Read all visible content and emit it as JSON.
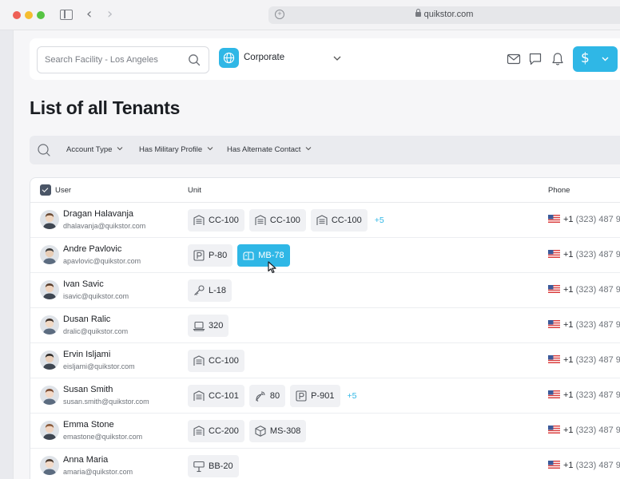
{
  "browser": {
    "url": "quikstor.com"
  },
  "header": {
    "search_placeholder": "Search Facility - Los Angeles",
    "organization": "Corporate",
    "icons": [
      "mail-icon",
      "chat-icon",
      "bell-icon"
    ],
    "money_button_symbol": "$"
  },
  "page": {
    "title": "List of all Tenants"
  },
  "filters": [
    {
      "label": "Account Type"
    },
    {
      "label": "Has Military Profile"
    },
    {
      "label": "Has Alternate Contact"
    }
  ],
  "table": {
    "columns": {
      "user": "User",
      "unit": "Unit",
      "phone": "Phone"
    },
    "rows": [
      {
        "name": "Dragan Halavanja",
        "email": "dhalavanja@quikstor.com",
        "phone_cc": "+1",
        "phone_rest": "(323) 487 9",
        "units": [
          {
            "label": "CC-100",
            "icon": "building"
          },
          {
            "label": "CC-100",
            "icon": "building"
          },
          {
            "label": "CC-100",
            "icon": "building"
          }
        ],
        "more": "+5"
      },
      {
        "name": "Andre Pavlovic",
        "email": "apavlovic@quikstor.com",
        "phone_cc": "+1",
        "phone_rest": "(323) 487 9",
        "units": [
          {
            "label": "P-80",
            "icon": "parking"
          },
          {
            "label": "MB-78",
            "icon": "mailbox",
            "active": true
          }
        ],
        "more": ""
      },
      {
        "name": "Ivan Savic",
        "email": "isavic@quikstor.com",
        "phone_cc": "+1",
        "phone_rest": "(323) 487 9",
        "units": [
          {
            "label": "L-18",
            "icon": "key"
          }
        ],
        "more": ""
      },
      {
        "name": "Dusan Ralic",
        "email": "dralic@quikstor.com",
        "phone_cc": "+1",
        "phone_rest": "(323) 487 9",
        "units": [
          {
            "label": "320",
            "icon": "laptop"
          }
        ],
        "more": ""
      },
      {
        "name": "Ervin Isljami",
        "email": "eisljami@quikstor.com",
        "phone_cc": "+1",
        "phone_rest": "(323) 487 9",
        "units": [
          {
            "label": "CC-100",
            "icon": "building"
          }
        ],
        "more": ""
      },
      {
        "name": "Susan Smith",
        "email": "susan.smith@quikstor.com",
        "phone_cc": "+1",
        "phone_rest": "(323) 487 9",
        "units": [
          {
            "label": "CC-101",
            "icon": "building"
          },
          {
            "label": "80",
            "icon": "satellite"
          },
          {
            "label": "P-901",
            "icon": "parking"
          }
        ],
        "more": "+5"
      },
      {
        "name": "Emma Stone",
        "email": "emastone@quikstor.com",
        "phone_cc": "+1",
        "phone_rest": "(323) 487 9",
        "units": [
          {
            "label": "CC-200",
            "icon": "building"
          },
          {
            "label": "MS-308",
            "icon": "box"
          }
        ],
        "more": ""
      },
      {
        "name": "Anna Maria",
        "email": "amaria@quikstor.com",
        "phone_cc": "+1",
        "phone_rest": "(323) 487 9",
        "units": [
          {
            "label": "BB-20",
            "icon": "signboard"
          }
        ],
        "more": ""
      }
    ]
  },
  "colors": {
    "accent": "#2fb7e6",
    "link": "#2fb7e6"
  }
}
